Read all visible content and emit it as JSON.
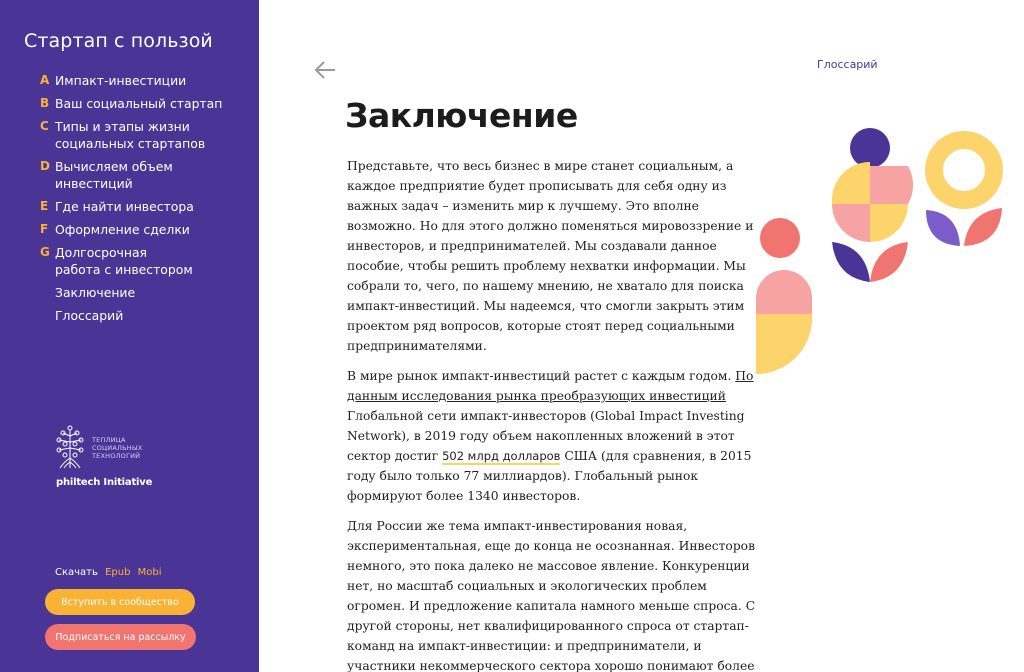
{
  "sidebar": {
    "brand": "Стартап с пользой",
    "nav": [
      {
        "letter": "A",
        "label": "Импакт-инвестиции"
      },
      {
        "letter": "B",
        "label": "Ваш социальный стартап"
      },
      {
        "letter": "C",
        "label": "Типы и этапы жизни\nсоциальных стартапов"
      },
      {
        "letter": "D",
        "label": "Вычисляем объем\nинвестиций"
      },
      {
        "letter": "E",
        "label": "Где найти инвестора"
      },
      {
        "letter": "F",
        "label": "Оформление сделки"
      },
      {
        "letter": "G",
        "label": "Долгосрочная\nработа с инвестором"
      },
      {
        "letter": "",
        "label": "Заключение"
      },
      {
        "letter": "",
        "label": "Глоссарий"
      }
    ],
    "logo": {
      "subtitle": "ТЕПЛИЦА\nСОЦИАЛЬНЫХ\nТЕХНОЛОГИЙ",
      "name": "philtech Initiative"
    },
    "download": {
      "label": "Скачать",
      "epub": "Epub",
      "mobi": "Mobi"
    },
    "join_button": "Вступить в сообщество",
    "subscribe_button": "Подписаться на рассылку"
  },
  "header": {
    "back_icon": "arrow-left-icon",
    "glossary_link": "Глоссарий"
  },
  "main": {
    "title": "Заключение",
    "p1": "Представьте, что весь бизнес в мире станет социальным, а каждое предприятие будет прописывать для себя одну из важных задач – изменить мир к лучшему. Это вполне возможно. Но для этого должно поменяться мировоззрение и инвесторов, и предпринимателей. Мы создавали данное пособие, чтобы решить проблему нехватки информации. Мы собрали то, чего, по нашему мнению, не хватало для поиска импакт-инвестиций. Мы надеемся, что смогли закрыть этим проектом ряд вопросов, которые стоят перед социальными предпринимателями.",
    "p2_start": "В мире рынок импакт-инвестиций растет с каждым годом. ",
    "p2_link": "По данным исследования рынка преобразующих инвестиций",
    "p2_mid": " Глобальной сети импакт-инвесторов (Global Impact Investing Network), в 2019 году объем накопленных вложений в этот сектор достиг ",
    "p2_highlight": "502 млрд долларов",
    "p2_end": " США (для сравнения, в 2015 году было только 77 миллиардов). Глобальный рынок формируют более 1340 инвесторов.",
    "p3": "Для России же тема импакт-инвестирования новая, экспериментальная, еще до конца не осознанная. Инвесторов немного, это пока далеко не массовое явление. Конкуренции нет, но масштаб социальных и экологических проблем огромен. И предложение капитала намного меньше спроса. С другой стороны, нет квалифицированного спроса от стартап-команд на импакт-инвестиции: и предприниматели, и участники некоммерческого сектора хорошо понимают более"
  },
  "colors": {
    "sidebar_bg": "#4a3597",
    "accent_yellow": "#f9b233",
    "accent_coral": "#f07470",
    "flower_yellow": "#fdd46b",
    "flower_pink": "#f7a3a3",
    "flower_purple": "#4a3597",
    "flower_violet": "#7c5cc8"
  }
}
